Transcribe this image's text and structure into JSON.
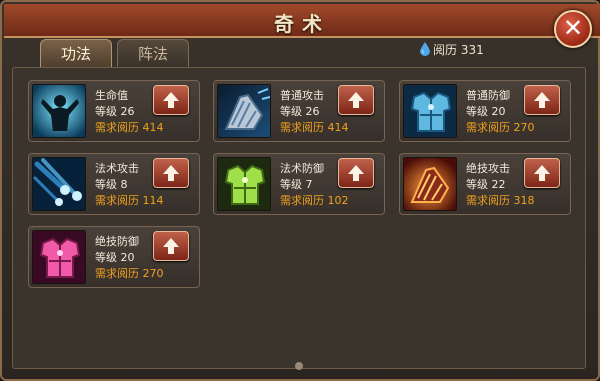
{
  "window": {
    "title": "奇术"
  },
  "tabs": [
    {
      "label": "功法",
      "active": true
    },
    {
      "label": "阵法",
      "active": false
    }
  ],
  "currency": {
    "label": "阅历",
    "value": "331",
    "icon": "water-drop-icon"
  },
  "skills": [
    {
      "name": "生命值",
      "level_text": "等级 26",
      "req_text": "需求阅历 414",
      "icon": "muscle-figure-icon"
    },
    {
      "name": "普通攻击",
      "level_text": "等级 26",
      "req_text": "需求阅历 414",
      "icon": "gauntlet-icon"
    },
    {
      "name": "普通防御",
      "level_text": "等级 20",
      "req_text": "需求阅历 270",
      "icon": "blue-armor-icon"
    },
    {
      "name": "法术攻击",
      "level_text": "等级 8",
      "req_text": "需求阅历 114",
      "icon": "meteor-icon"
    },
    {
      "name": "法术防御",
      "level_text": "等级 7",
      "req_text": "需求阅历 102",
      "icon": "green-armor-icon"
    },
    {
      "name": "绝技攻击",
      "level_text": "等级 22",
      "req_text": "需求阅历 318",
      "icon": "fire-gauntlet-icon"
    },
    {
      "name": "绝技防御",
      "level_text": "等级 20",
      "req_text": "需求阅历 270",
      "icon": "pink-armor-icon"
    }
  ],
  "colors": {
    "accent": "#f0a21e",
    "title_bar": "#8a3a20",
    "button": "#a94430"
  }
}
